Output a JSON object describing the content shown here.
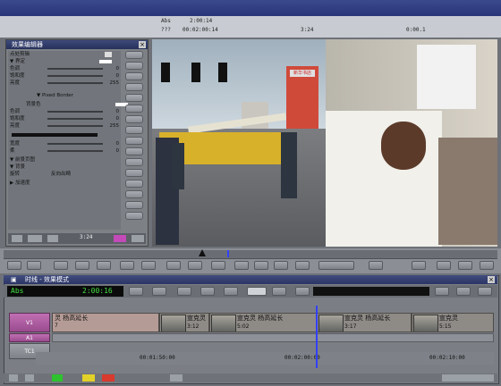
{
  "timebar": {
    "abs_label": "Abs",
    "abs_time": "2:00:14",
    "q_label": "???",
    "q_time": "00:02:00:14",
    "duration": "3:24",
    "zero": "0:00.1"
  },
  "effect_panel": {
    "title": "效果编辑器",
    "section1": "点处剪辑",
    "rows": [
      {
        "label": "▼ 界定",
        "value": ""
      },
      {
        "label": "色调",
        "value": "0"
      },
      {
        "label": "饱和度",
        "value": "0"
      },
      {
        "label": "亮度",
        "value": "255"
      },
      {
        "label": "▼ Pixed Border",
        "value": ""
      },
      {
        "label": "背景色",
        "value": ""
      },
      {
        "label": "色调",
        "value": "0"
      },
      {
        "label": "饱和度",
        "value": "0"
      },
      {
        "label": "亮度",
        "value": "255"
      },
      {
        "label": "宽度",
        "value": "0"
      },
      {
        "label": "柔",
        "value": "0"
      },
      {
        "label": "▼ 前景页图",
        "value": ""
      },
      {
        "label": "▼ 背景",
        "value": ""
      },
      {
        "label": "旋转",
        "value": "0"
      },
      {
        "label": "▶ 加速度",
        "value": ""
      }
    ],
    "flip_label": "反向出畸",
    "timecode": "3:24"
  },
  "video": {
    "sign_text": "新华书店"
  },
  "timeline": {
    "title": "时线 - 效果模式",
    "abs_label": "Abs",
    "abs_time": "2:00:16",
    "tracks": [
      {
        "name": "V1"
      },
      {
        "name": "A1"
      },
      {
        "name": "TC1"
      }
    ],
    "clips": [
      {
        "label": "灵 杨高延长",
        "sub": "7"
      },
      {
        "label": "宣克灵",
        "sub": "3:12"
      },
      {
        "label": "宣克灵 杨高延长",
        "sub": "5:02"
      },
      {
        "label": "宣克灵 杨高延长",
        "sub": "3:17"
      },
      {
        "label": "宣克灵",
        "sub": "5:15"
      }
    ],
    "ruler": [
      "00:01:50:00",
      "00:02:00:00",
      "00:02:10:00"
    ]
  },
  "colors": {
    "accent_marker": "#3340ff",
    "timecode_green": "#43e043",
    "track_label": "#b062a5"
  }
}
